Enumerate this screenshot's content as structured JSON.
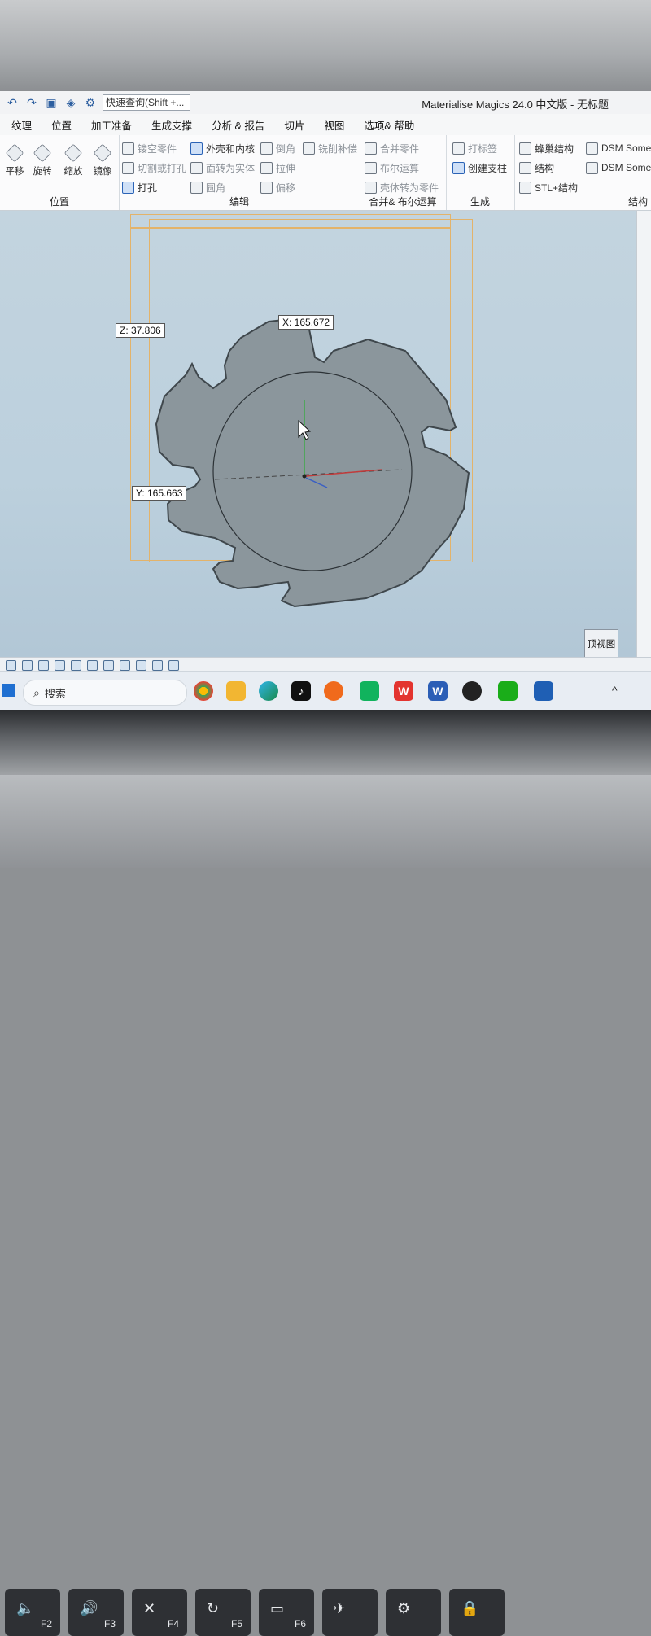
{
  "window": {
    "title": "Materialise Magics 24.0 中文版 - 无标题",
    "quick_search_placeholder": "快速查询(Shift +..."
  },
  "menu": [
    "纹理",
    "位置",
    "加工准备",
    "生成支撑",
    "分析 & 报告",
    "切片",
    "视图",
    "选项& 帮助"
  ],
  "ribbon": {
    "position": {
      "label": "位置",
      "buttons": [
        "平移",
        "旋转",
        "缩放",
        "镜像"
      ]
    },
    "edit": {
      "label": "编辑",
      "items": [
        "镂空零件",
        "外壳和内核",
        "倒角",
        "铣削补偿",
        "切割或打孔",
        "面转为实体",
        "拉伸",
        "打孔",
        "圆角",
        "偏移"
      ]
    },
    "boolean": {
      "label": "合并& 布尔运算",
      "items": [
        "合并零件",
        "布尔运算",
        "壳体转为零件"
      ]
    },
    "generate": {
      "label": "生成",
      "items": [
        "打标签",
        "创建支柱"
      ]
    },
    "structure": {
      "label": "结构",
      "items": [
        "蜂巢结构",
        "结构",
        "STL+结构",
        "DSM Some",
        "DSM Some"
      ]
    }
  },
  "viewport": {
    "dimensions": {
      "x": "X: 165.672",
      "y": "Y: 165.663",
      "z": "Z: 37.806"
    },
    "view_cube_label": "顶视图",
    "axis_label": "Z",
    "part_color": "#7f8a90",
    "bbox_color": "#e3b36a"
  },
  "taskbar": {
    "search_label": "搜索",
    "apps": [
      "windows-start",
      "chrome",
      "file-explorer",
      "edge",
      "tiktok",
      "search-app",
      "wechat-work",
      "wps",
      "word",
      "qq",
      "wechat",
      "magics"
    ]
  },
  "keyboard": {
    "keys": [
      "F2",
      "F3",
      "F4",
      "F5",
      "F6"
    ]
  }
}
